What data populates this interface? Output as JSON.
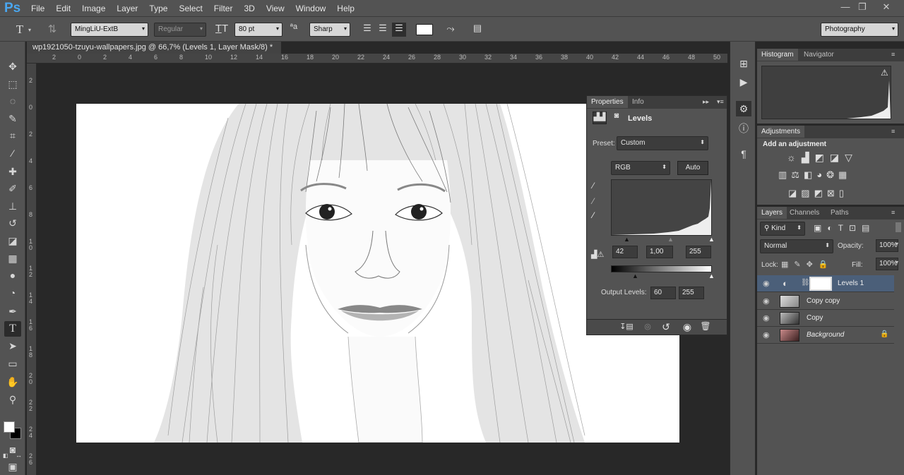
{
  "app": {
    "logo": "Ps"
  },
  "menu": [
    "File",
    "Edit",
    "Image",
    "Layer",
    "Type",
    "Select",
    "Filter",
    "3D",
    "View",
    "Window",
    "Help"
  ],
  "window_controls": [
    "—",
    "❐",
    "✕"
  ],
  "options": {
    "tool_icon": "T",
    "font_family": "MingLiU-ExtB",
    "font_style": "Regular",
    "font_size": "80 pt",
    "aa_label": "ªa",
    "antialias": "Sharp",
    "workspace": "Photography"
  },
  "document": {
    "tab_title": "wp1921050-tzuyu-wallpapers.jpg @ 66,7% (Levels 1, Layer Mask/8) *",
    "close": "×"
  },
  "ruler_h": [
    "2",
    "0",
    "2",
    "4",
    "6",
    "8",
    "10",
    "12",
    "14",
    "16",
    "18",
    "20",
    "22",
    "24",
    "26",
    "28",
    "30",
    "32",
    "34",
    "36",
    "38",
    "40",
    "42",
    "44",
    "46",
    "48",
    "50"
  ],
  "ruler_v": [
    "2",
    "0",
    "2",
    "4",
    "6",
    "8",
    "1 0",
    "1 2",
    "1 4",
    "1 6",
    "1 8",
    "2 0",
    "2 2",
    "2 4",
    "2 6"
  ],
  "properties": {
    "tabs": [
      "Properties",
      "Info"
    ],
    "title": "Levels",
    "preset_label": "Preset:",
    "preset_value": "Custom",
    "channel": "RGB",
    "auto_button": "Auto",
    "input_black": "42",
    "input_gamma": "1,00",
    "input_white": "255",
    "output_label": "Output Levels:",
    "output_black": "60",
    "output_white": "255"
  },
  "histogram_panel": {
    "tabs": [
      "Histogram",
      "Navigator"
    ],
    "warning": "⚠"
  },
  "adjustments": {
    "tab": "Adjustments",
    "title": "Add an adjustment"
  },
  "layers_panel": {
    "tabs": [
      "Layers",
      "Channels",
      "Paths"
    ],
    "filter": "Kind",
    "blend_mode": "Normal",
    "opacity_label": "Opacity:",
    "opacity": "100%",
    "lock_label": "Lock:",
    "fill_label": "Fill:",
    "fill": "100%",
    "layers": [
      {
        "name": "Levels 1",
        "selected": true
      },
      {
        "name": "Copy copy"
      },
      {
        "name": "Copy"
      },
      {
        "name": "Background",
        "italic": true
      }
    ]
  },
  "colors": {
    "accent": "#4aa7f0",
    "selected_layer": "#4b5f79"
  }
}
